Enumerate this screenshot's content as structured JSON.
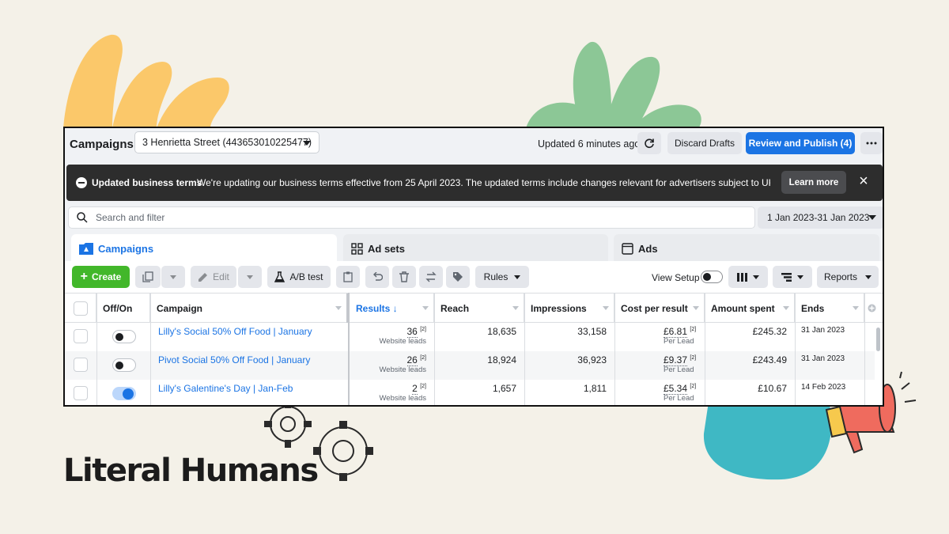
{
  "brand": {
    "name": "Literal Humans"
  },
  "colors": {
    "accent": "#1b74e4",
    "create": "#42b72a",
    "banner": "#2d2d2d"
  },
  "topbar": {
    "title": "Campaigns",
    "account": "3 Henrietta Street (443653010225477)",
    "updated": "Updated 6 minutes ago",
    "discard": "Discard Drafts",
    "publish": "Review and Publish (4)"
  },
  "banner": {
    "title": "Updated business terms",
    "text": "We're updating our business terms effective from 25 April 2023. The updated terms include changes relevant for advertisers subject to UK GDPR (Ge...",
    "learn_more": "Learn more"
  },
  "search": {
    "placeholder": "Search and filter",
    "date_range": "1 Jan 2023-31 Jan 2023"
  },
  "tabs": [
    {
      "label": "Campaigns",
      "icon": "folder-icon"
    },
    {
      "label": "Ad sets",
      "icon": "grid-icon"
    },
    {
      "label": "Ads",
      "icon": "ad-icon"
    }
  ],
  "toolbar": {
    "create": "Create",
    "edit": "Edit",
    "ab_test": "A/B test",
    "rules": "Rules",
    "view_setup": "View Setup",
    "reports": "Reports"
  },
  "table": {
    "headers": {
      "off_on": "Off/On",
      "campaign": "Campaign",
      "results": "Results ↓",
      "reach": "Reach",
      "impressions": "Impressions",
      "cost_per_result": "Cost per result",
      "amount_spent": "Amount spent",
      "ends": "Ends"
    },
    "rows": [
      {
        "on": false,
        "campaign": "Lilly's Social 50% Off Food | January",
        "results": "36",
        "results_note": "[2]",
        "results_sub": "Website leads",
        "reach": "18,635",
        "impressions": "33,158",
        "cpr": "£6.81",
        "cpr_note": "[2]",
        "cpr_sub": "Per Lead",
        "spent": "£245.32",
        "ends": "31 Jan 2023"
      },
      {
        "on": false,
        "campaign": "Pivot Social 50% Off Food | January",
        "results": "26",
        "results_note": "[2]",
        "results_sub": "Website leads",
        "reach": "18,924",
        "impressions": "36,923",
        "cpr": "£9.37",
        "cpr_note": "[2]",
        "cpr_sub": "Per Lead",
        "spent": "£243.49",
        "ends": "31 Jan 2023"
      },
      {
        "on": true,
        "campaign": "Lilly's Galentine's Day | Jan-Feb",
        "results": "2",
        "results_note": "[2]",
        "results_sub": "Website leads",
        "reach": "1,657",
        "impressions": "1,811",
        "cpr": "£5.34",
        "cpr_note": "[2]",
        "cpr_sub": "Per Lead",
        "spent": "£10.67",
        "ends": "14 Feb 2023"
      }
    ]
  }
}
